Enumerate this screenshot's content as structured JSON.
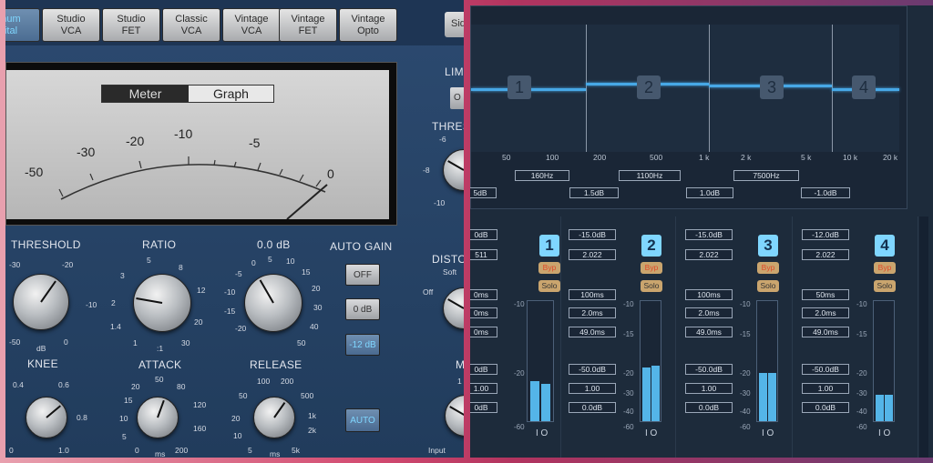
{
  "compressor": {
    "types": [
      {
        "label": "num\nital",
        "active": true
      },
      {
        "label": "Studio\nVCA"
      },
      {
        "label": "Studio\nFET"
      },
      {
        "label": "Classic\nVCA"
      },
      {
        "label": "Vintage\nVCA"
      },
      {
        "label": "Vintage\nFET"
      },
      {
        "label": "Vintage\nOpto"
      }
    ],
    "side_label": "Sid",
    "meter_toggle": {
      "meter": "Meter",
      "graph": "Graph"
    },
    "meter_scale": [
      "-50",
      "-30",
      "-20",
      "-10",
      "-5",
      "0"
    ],
    "threshold": {
      "label": "THRESHOLD",
      "ticks": [
        "-30",
        "-20",
        "-10",
        "-50",
        "0"
      ],
      "unit": "dB"
    },
    "ratio": {
      "label": "RATIO",
      "ticks": [
        "5",
        "8",
        "3",
        "12",
        "2",
        "20",
        "1.4",
        "30",
        "1",
        ":1"
      ]
    },
    "makeup": {
      "label": "0.0 dB",
      "ticks": [
        "5",
        "0",
        "10",
        "15",
        "-5",
        "20",
        "-10",
        "30",
        "-15",
        "40",
        "-20",
        "50"
      ]
    },
    "auto_gain": {
      "label": "AUTO GAIN",
      "off": "OFF",
      "zero": "0 dB",
      "minus12": "-12 dB"
    },
    "knee": {
      "label": "KNEE",
      "ticks": [
        "0.4",
        "0.6",
        "0.8",
        "0",
        "1.0"
      ]
    },
    "attack": {
      "label": "ATTACK",
      "ticks": [
        "50",
        "20",
        "80",
        "15",
        "120",
        "10",
        "160",
        "5",
        "200",
        "0",
        "ms"
      ]
    },
    "release": {
      "label": "RELEASE",
      "ticks": [
        "100",
        "200",
        "50",
        "500",
        "20",
        "1k",
        "10",
        "2k",
        "5",
        "ms",
        "5k"
      ]
    },
    "auto_label": "AUTO",
    "limiter_label": "LIMI",
    "limiter_btn": "O",
    "thresh_label": "THRES",
    "thresh_ticks": [
      "-6",
      "-8",
      "-10"
    ],
    "distortion": {
      "label": "DISTO",
      "sub": "Soft",
      "off": "Off"
    },
    "mix": {
      "label": "M",
      "sub": "Input",
      "tick": "1"
    }
  },
  "multiband": {
    "freq_ticks": [
      "50",
      "100",
      "200",
      "500",
      "1 k",
      "2 k",
      "5 k",
      "10 k",
      "20 k"
    ],
    "crossovers": [
      "160Hz",
      "1100Hz",
      "7500Hz"
    ],
    "gains": [
      "5dB",
      "1.5dB",
      "1.0dB",
      "-1.0dB"
    ],
    "band_numbers": [
      "1",
      "2",
      "3",
      "4"
    ],
    "bands": [
      {
        "num": "1",
        "threshold": "0dB",
        "ratio": "511",
        "attack": "0ms",
        "release": "0ms",
        "look": "0ms",
        "range": "0dB",
        "makeup": "1.00",
        "out": "0dB",
        "meter": [
          0.33,
          0.31
        ]
      },
      {
        "num": "2",
        "threshold": "-15.0dB",
        "ratio": "2.022",
        "attack": "100ms",
        "release": "2.0ms",
        "look": "49.0ms",
        "range": "-50.0dB",
        "makeup": "1.00",
        "out": "0.0dB",
        "meter": [
          0.45,
          0.46
        ]
      },
      {
        "num": "3",
        "threshold": "-15.0dB",
        "ratio": "2.022",
        "attack": "100ms",
        "release": "2.0ms",
        "look": "49.0ms",
        "range": "-50.0dB",
        "makeup": "1.00",
        "out": "0.0dB",
        "meter": [
          0.4,
          0.4
        ]
      },
      {
        "num": "4",
        "threshold": "-12.0dB",
        "ratio": "2.022",
        "attack": "50ms",
        "release": "2.0ms",
        "look": "49.0ms",
        "range": "-50.0dB",
        "makeup": "1.00",
        "out": "0.0dB",
        "meter": [
          0.22,
          0.22
        ]
      }
    ],
    "byp": "Byp",
    "solo": "Solo",
    "meter_scale": [
      "-10",
      "-15",
      "-20",
      "-30",
      "-40",
      "-60"
    ],
    "io": "I O"
  }
}
